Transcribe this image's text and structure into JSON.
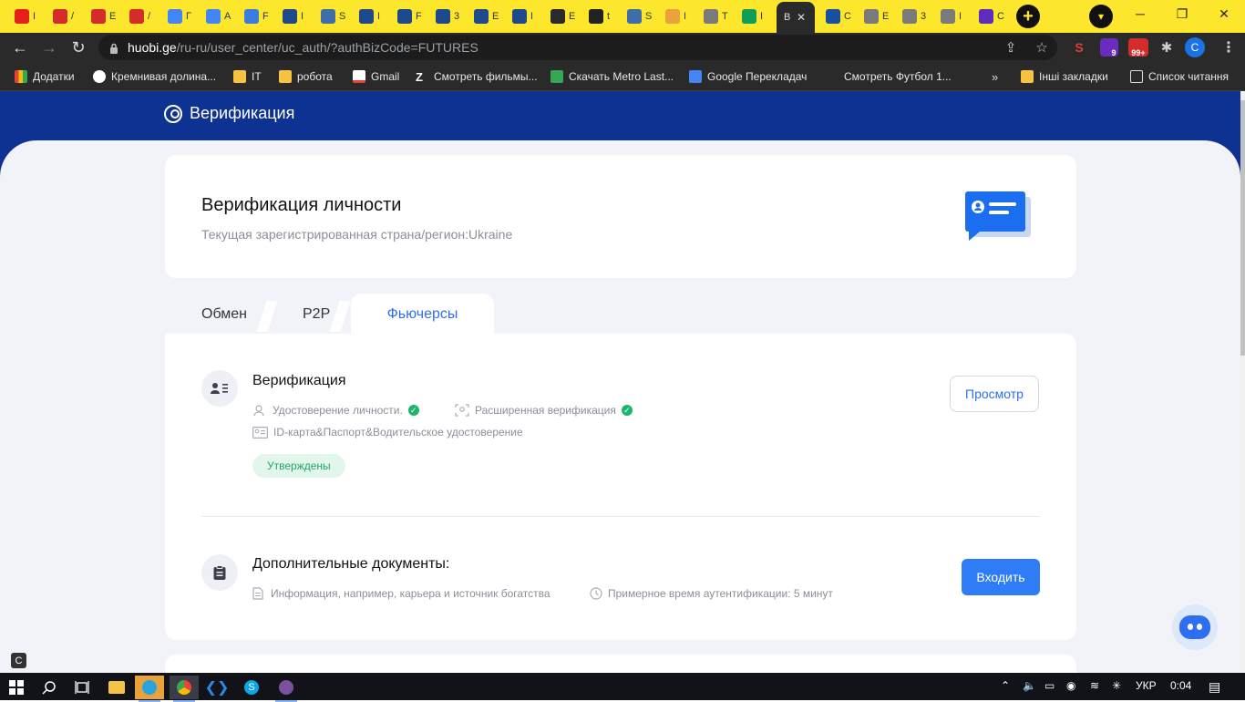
{
  "browser": {
    "active_tab_label": "В",
    "url_host": "huobi.ge",
    "url_path": "/ru-ru/user_center/uc_auth/?authBizCode=FUTURES",
    "profile_initial": "С",
    "extension_badges": [
      "9",
      "99+"
    ],
    "tabs": [
      {
        "label": "I",
        "color": "#e62117"
      },
      {
        "label": "/",
        "color": "#d42b2b"
      },
      {
        "label": "E",
        "color": "#d42b2b"
      },
      {
        "label": "/",
        "color": "#d42b2b"
      },
      {
        "label": "Г",
        "color": "#4285f4"
      },
      {
        "label": "A",
        "color": "#4285f4"
      },
      {
        "label": "F",
        "color": "#3d7be0"
      },
      {
        "label": "I",
        "color": "#1e4a8c"
      },
      {
        "label": "S",
        "color": "#3e6ea8"
      },
      {
        "label": "I",
        "color": "#1e4a8c"
      },
      {
        "label": "F",
        "color": "#1e4a8c"
      },
      {
        "label": "3",
        "color": "#1e4a8c"
      },
      {
        "label": "E",
        "color": "#1e4a8c"
      },
      {
        "label": "I",
        "color": "#1e4a8c"
      },
      {
        "label": "E",
        "color": "#2a2a2a"
      },
      {
        "label": "t",
        "color": "#222222"
      },
      {
        "label": "S",
        "color": "#3e6ea8"
      },
      {
        "label": "I",
        "color": "#e8a33d"
      },
      {
        "label": "T",
        "color": "#7a7a7a"
      },
      {
        "label": "I",
        "color": "#0f9d58"
      }
    ],
    "tabs_after_active": [
      {
        "label": "C",
        "color": "#1a4fa0"
      },
      {
        "label": "E",
        "color": "#7a7a7a"
      },
      {
        "label": "3",
        "color": "#7a7a7a"
      },
      {
        "label": "I",
        "color": "#7a7a7a"
      },
      {
        "label": "C",
        "color": "#5d2dbe"
      }
    ]
  },
  "bookmarks": [
    {
      "label": "Додатки",
      "color": "#e8e8e8"
    },
    {
      "label": "Кремнивая долина...",
      "color": "#ffffff"
    },
    {
      "label": "IT",
      "color": "#f6c343"
    },
    {
      "label": "робота",
      "color": "#f6c343"
    },
    {
      "label": "Gmail",
      "color": "#ea4335"
    },
    {
      "label": "Смотреть фильмы...",
      "color": "#ffffff"
    },
    {
      "label": "Скачать Metro Last...",
      "color": "#34a853"
    },
    {
      "label": "Google Перекладач",
      "color": "#4285f4"
    },
    {
      "label": "Смотреть Футбол 1...",
      "color": "#2a2a2a"
    },
    {
      "label": "Інші закладки",
      "color": "#f6c343"
    },
    {
      "label": "Список читання",
      "color": "#e8e8e8"
    }
  ],
  "page": {
    "header_title": "Верификация",
    "identity_title": "Верификация личности",
    "identity_sub": "Текущая зарегистрированная страна/регион:Ukraine",
    "tabs": [
      "Обмен",
      "P2P",
      "Фьючерсы"
    ],
    "verification": {
      "title": "Верификация",
      "item1": "Удостоверение личности.",
      "item2": "Расширенная верификация",
      "docs": "ID-карта&Паспорт&Водительское удостоверение",
      "status": "Утверждены",
      "view_button": "Просмотр"
    },
    "additional": {
      "title": "Дополнительные документы:",
      "info": "Информация, например, карьера и источник богатства",
      "time": "Примерное время аутентификации: 5 минут",
      "enter_button": "Входить"
    }
  },
  "taskbar": {
    "lang": "УКР",
    "time": "0:04"
  },
  "colors": {
    "brand_blue": "#0d3291",
    "accent_blue": "#2e6ef0",
    "success_green": "#1fb46e"
  }
}
